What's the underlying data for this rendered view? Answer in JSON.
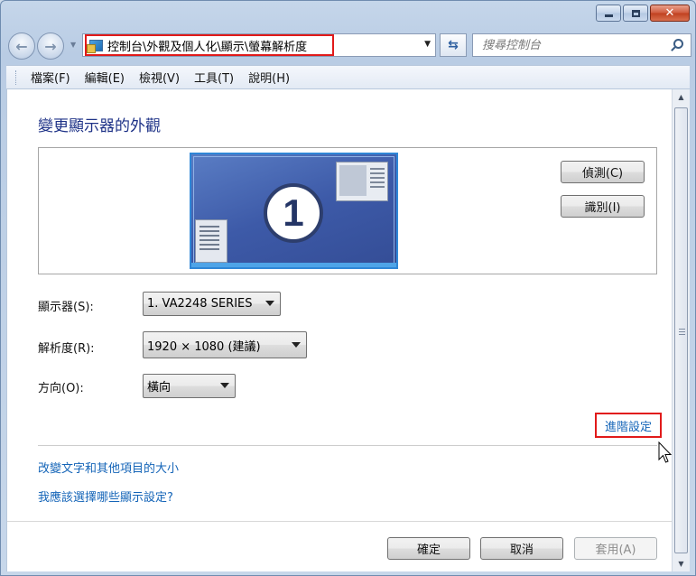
{
  "window": {
    "caption_buttons": {
      "minimize_icon": "minimize-icon",
      "maximize_icon": "maximize-icon",
      "close_icon": "close-icon",
      "close_glyph": "✕"
    }
  },
  "nav": {
    "back_icon": "back-arrow-icon",
    "forward_icon": "forward-arrow-icon",
    "address_path": "控制台\\外觀及個人化\\顯示\\螢幕解析度",
    "refresh_icon": "refresh-icon",
    "search_placeholder": "搜尋控制台"
  },
  "menu": {
    "items": [
      "檔案(F)",
      "編輯(E)",
      "檢視(V)",
      "工具(T)",
      "說明(H)"
    ]
  },
  "main": {
    "title": "變更顯示器的外觀",
    "monitor_number": "1",
    "detect_label": "偵測(C)",
    "identify_label": "識別(I)",
    "display_label": "顯示器(S):",
    "display_value": "1. VA2248 SERIES",
    "resolution_label": "解析度(R):",
    "resolution_value": "1920 × 1080 (建議)",
    "orientation_label": "方向(O):",
    "orientation_value": "橫向",
    "advanced_link": "進階設定",
    "link_text_size": "改變文字和其他項目的大小",
    "link_which_settings": "我應該選擇哪些顯示設定?"
  },
  "footer": {
    "ok_label": "確定",
    "cancel_label": "取消",
    "apply_label": "套用(A)"
  },
  "colors": {
    "title_blue": "#1e3287",
    "link_blue": "#1565b8",
    "highlight_red": "#e11a1a"
  }
}
